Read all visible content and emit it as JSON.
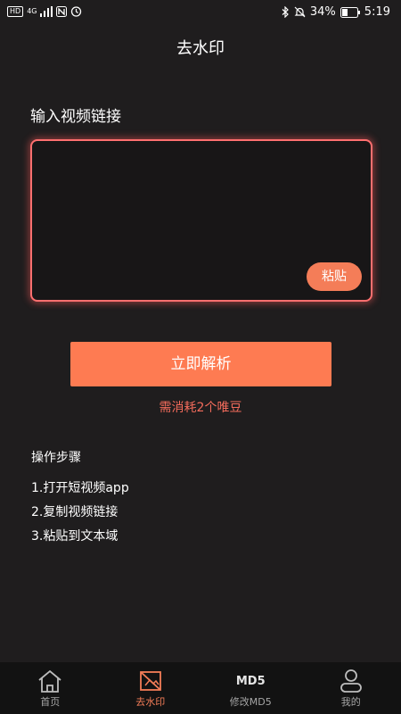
{
  "status_bar": {
    "hd": "HD",
    "net": "4G",
    "battery": "34%",
    "time": "5:19"
  },
  "header": {
    "title": "去水印"
  },
  "form": {
    "label": "输入视频链接",
    "paste_label": "粘贴",
    "parse_label": "立即解析",
    "cost_note": "需消耗2个唯豆"
  },
  "steps": {
    "title": "操作步骤",
    "items": [
      "1.打开短视频app",
      "2.复制视频链接",
      "3.粘贴到文本域"
    ]
  },
  "tabbar": {
    "active_color": "#f47d58",
    "tabs": [
      {
        "label": "首页",
        "icon": "home-icon"
      },
      {
        "label": "去水印",
        "icon": "watermark-icon"
      },
      {
        "label": "修改MD5",
        "icon_text": "MD5"
      },
      {
        "label": "我的",
        "icon": "user-icon"
      }
    ]
  }
}
